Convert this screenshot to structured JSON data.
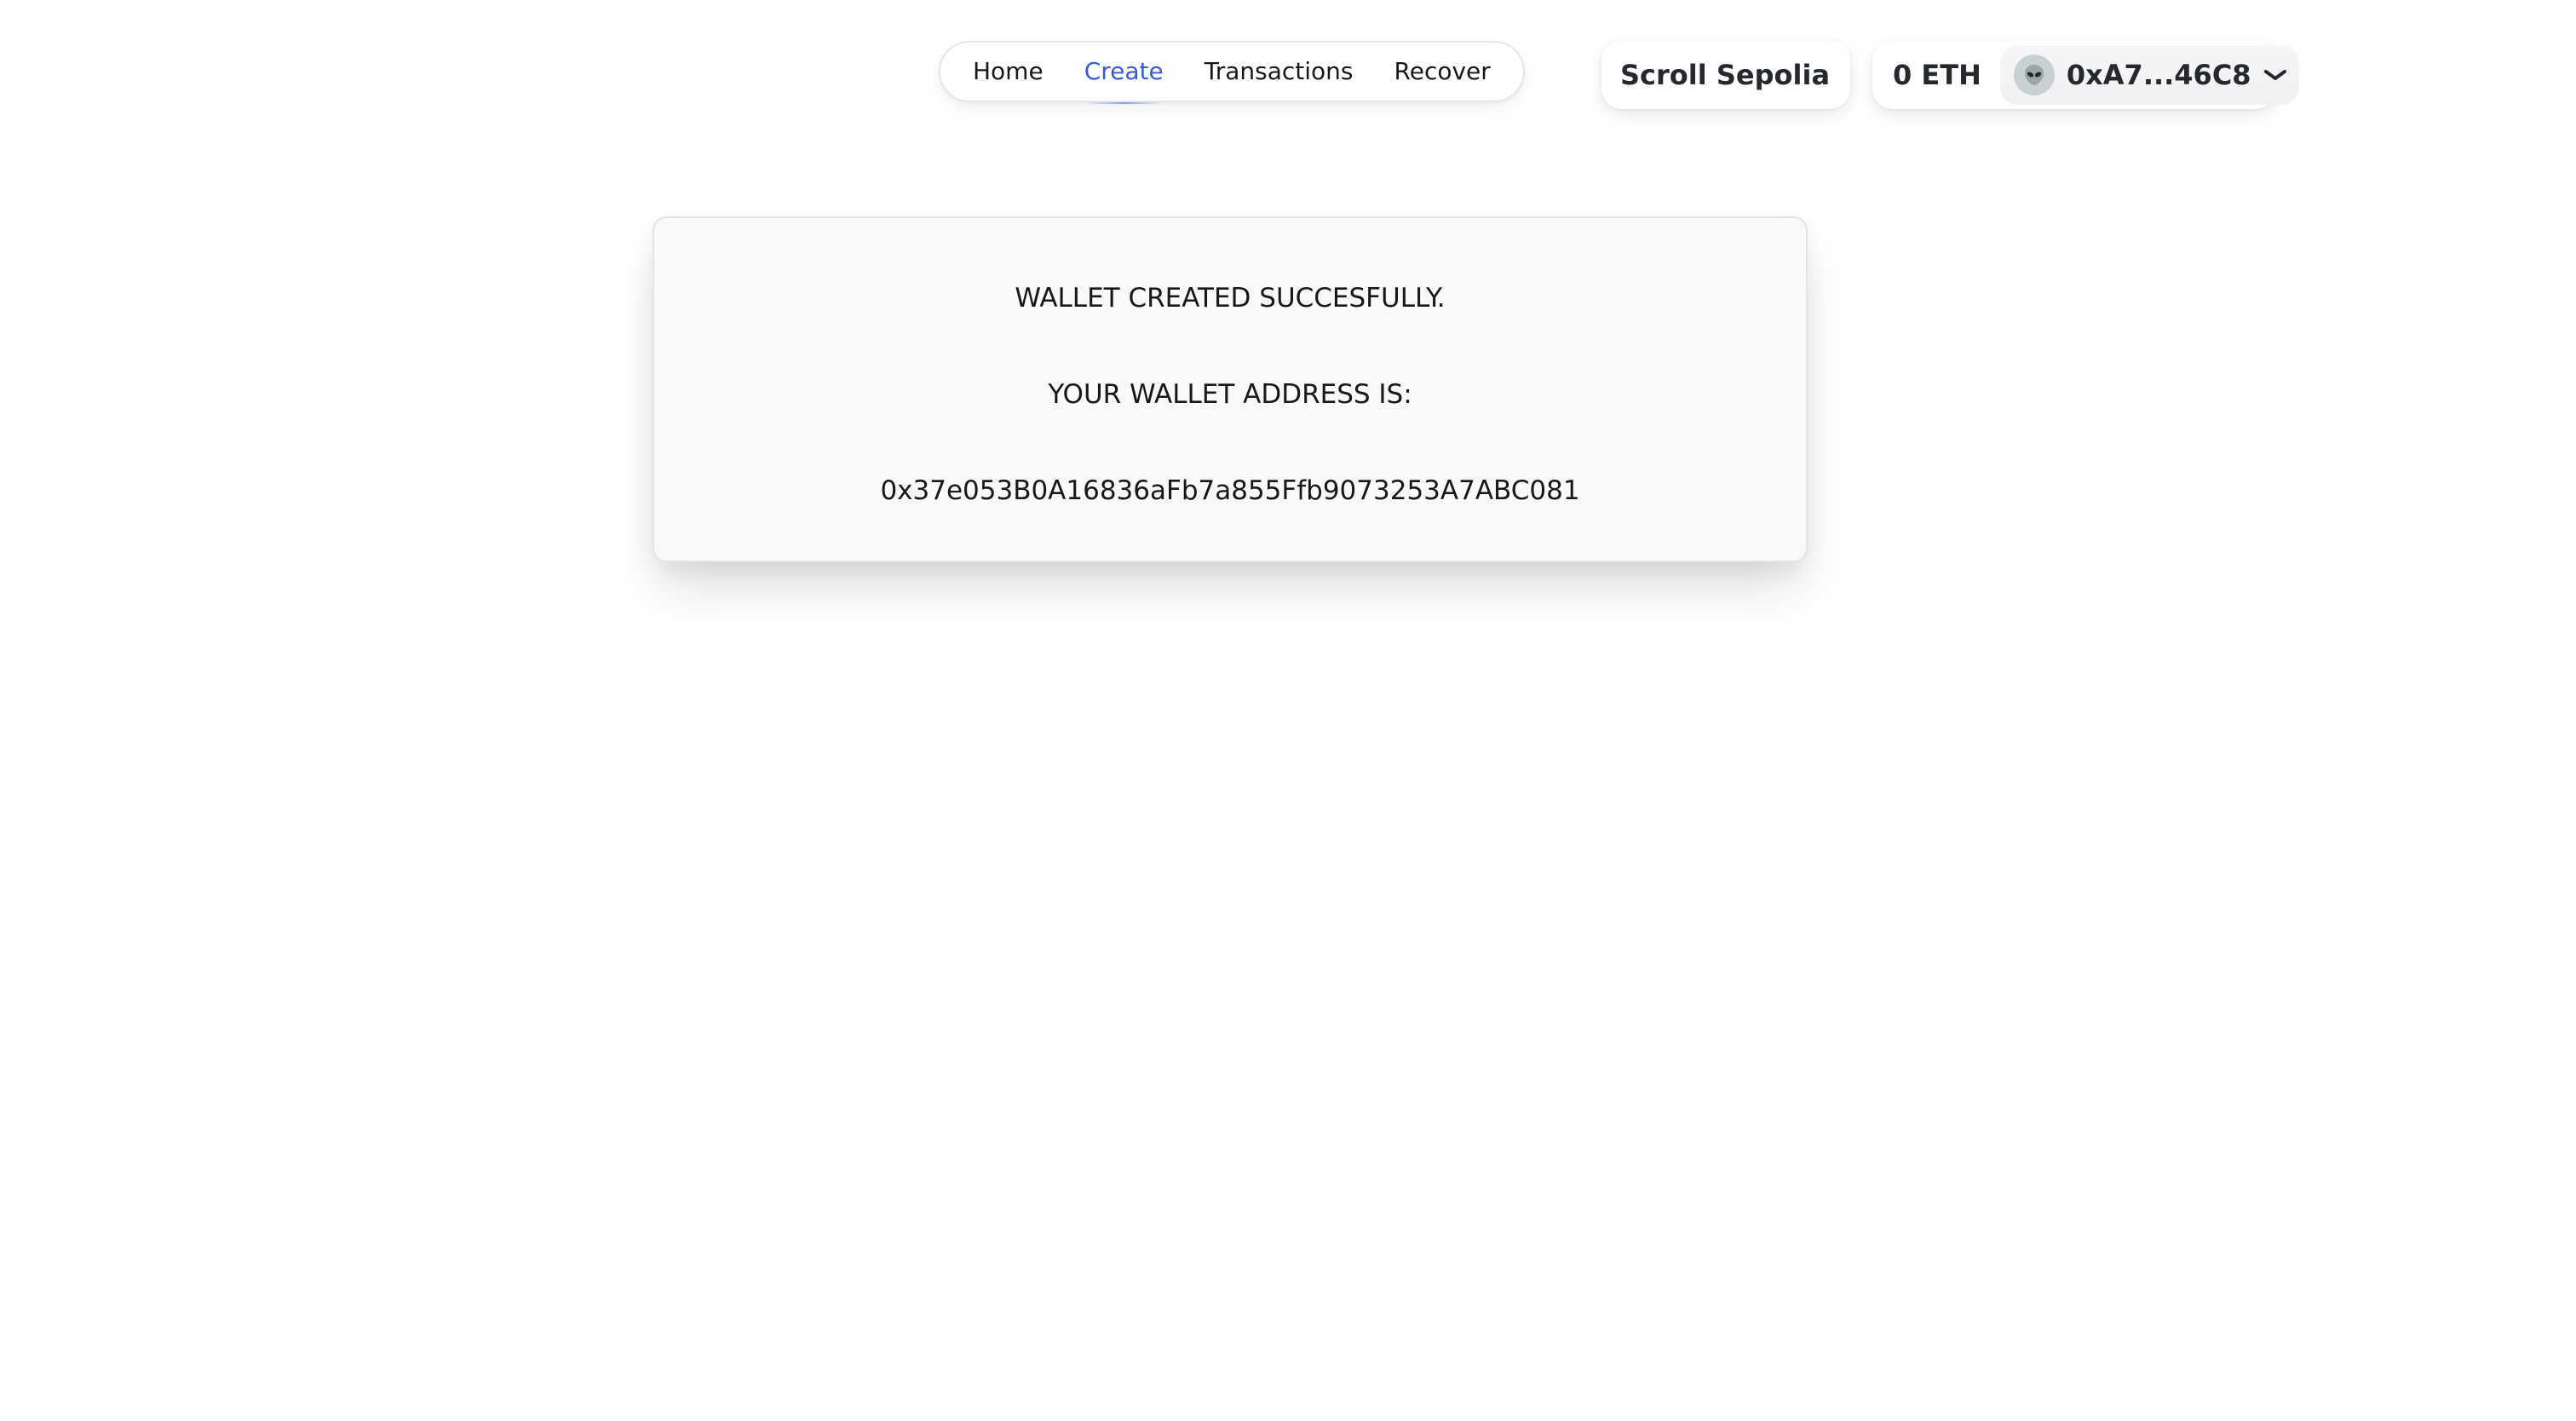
{
  "nav": {
    "items": [
      {
        "label": "Home",
        "active": false
      },
      {
        "label": "Create",
        "active": true
      },
      {
        "label": "Transactions",
        "active": false
      },
      {
        "label": "Recover",
        "active": false
      }
    ],
    "active_color": "#3b5bdb"
  },
  "network": {
    "name": "Scroll Sepolia",
    "icon": "chevron-down-icon"
  },
  "account": {
    "balance": "0 ETH",
    "address_short": "0xA7...46C8",
    "avatar_icon": "alien-emoji-icon",
    "avatar_color": "#c7d0d2",
    "icon": "chevron-down-icon"
  },
  "result": {
    "title": "WALLET CREATED SUCCESFULLY.",
    "address_label": "YOUR WALLET ADDRESS IS:",
    "address": "0x37e053B0A16836aFb7a855Ffb9073253A7ABC081"
  }
}
